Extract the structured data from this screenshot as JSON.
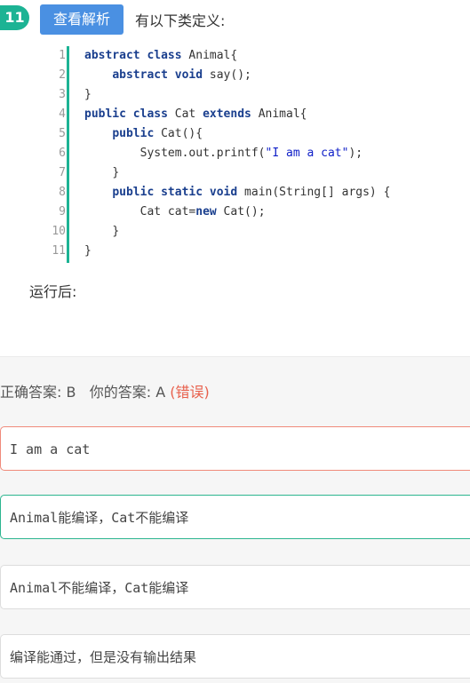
{
  "question": {
    "number": "11",
    "explain_label": "查看解析",
    "stem": "有以下类定义:",
    "after_code": "运行后:"
  },
  "code": {
    "line_numbers": [
      "1",
      "2",
      "3",
      "4",
      "5",
      "6",
      "7",
      "8",
      "9",
      "10",
      "11"
    ],
    "tokens": [
      {
        "kw1": "abstract",
        "sp1": " ",
        "kw2": "class",
        "rest": " Animal{"
      },
      {
        "indent": "    ",
        "kw1": "abstract",
        "sp1": " ",
        "kw2": "void",
        "rest": " say();"
      },
      {
        "rest": "}"
      },
      {
        "kw1": "public",
        "sp1": " ",
        "kw2": "class",
        "rest1": " Cat ",
        "kw3": "extends",
        "rest": " Animal{"
      },
      {
        "indent": "    ",
        "kw1": "public",
        "rest": " Cat(){"
      },
      {
        "indent": "        ",
        "pre": "System.out.printf(",
        "str": "\"I am a cat\"",
        "rest": ");"
      },
      {
        "indent": "    ",
        "rest": "}"
      },
      {
        "indent": "    ",
        "kw1": "public",
        "sp1": " ",
        "kw2": "static",
        "sp2": " ",
        "kw3": "void",
        "rest": " main(String[] args) {"
      },
      {
        "indent": "        ",
        "pre": "Cat cat=",
        "kw1": "new",
        "rest": " Cat();"
      },
      {
        "indent": "    ",
        "rest": "}"
      },
      {
        "rest": "}"
      }
    ]
  },
  "answer": {
    "correct_label": "正确答案: B",
    "yours_label": "你的答案: A",
    "status": "(错误)"
  },
  "options": [
    {
      "text": "I am a cat"
    },
    {
      "prefix": "Animal",
      "text": "能编译，",
      "mid": "Cat",
      "suffix": "不能编译"
    },
    {
      "prefix": "Animal",
      "text": "不能编译，",
      "mid": "Cat",
      "suffix": "能编译"
    },
    {
      "text": "编译能通过，但是没有输出结果"
    }
  ],
  "colors": {
    "badge": "#1cb394",
    "button": "#4a90e2",
    "code_bar": "#1cb394",
    "wrong": "#e8604c",
    "correct_border": "#2cb58f",
    "wrong_border": "#f08a7a"
  }
}
